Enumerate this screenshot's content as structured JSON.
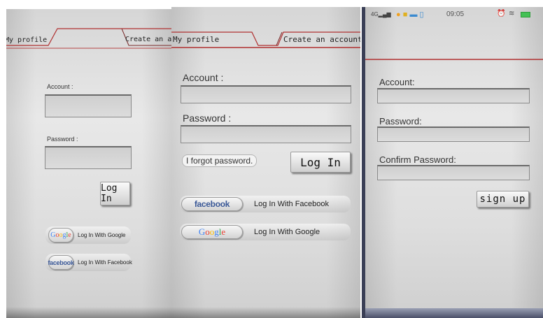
{
  "panel1": {
    "tabs": {
      "left": "My profile",
      "right": "Create an account"
    },
    "account_label": "Account :",
    "password_label": "Password :",
    "login_button": "Log In",
    "google_logo": "Google",
    "google_text": "Log In With Google",
    "facebook_logo": "facebook",
    "facebook_text": "Log In With Facebook"
  },
  "panel2": {
    "tabs": {
      "left": "My profile",
      "right": "Create an account"
    },
    "account_label": "Account  :",
    "password_label": "Password  :",
    "forgot_link": "I forgot password.",
    "login_button": "Log In",
    "facebook_logo": "facebook",
    "facebook_text": "Log In With Facebook",
    "google_logo": "Google",
    "google_text": "Log In With Google"
  },
  "panel3": {
    "status": {
      "signal": "4G",
      "time": "09:05",
      "battery": "battery-icon"
    },
    "account_label": "Account:",
    "password_label": "Password:",
    "confirm_label": "Confirm Password:",
    "signup_button": "sign up"
  },
  "colors": {
    "accent_red": "#b03030",
    "facebook_blue": "#3b5998",
    "frame_navy": "#3a3f56"
  }
}
